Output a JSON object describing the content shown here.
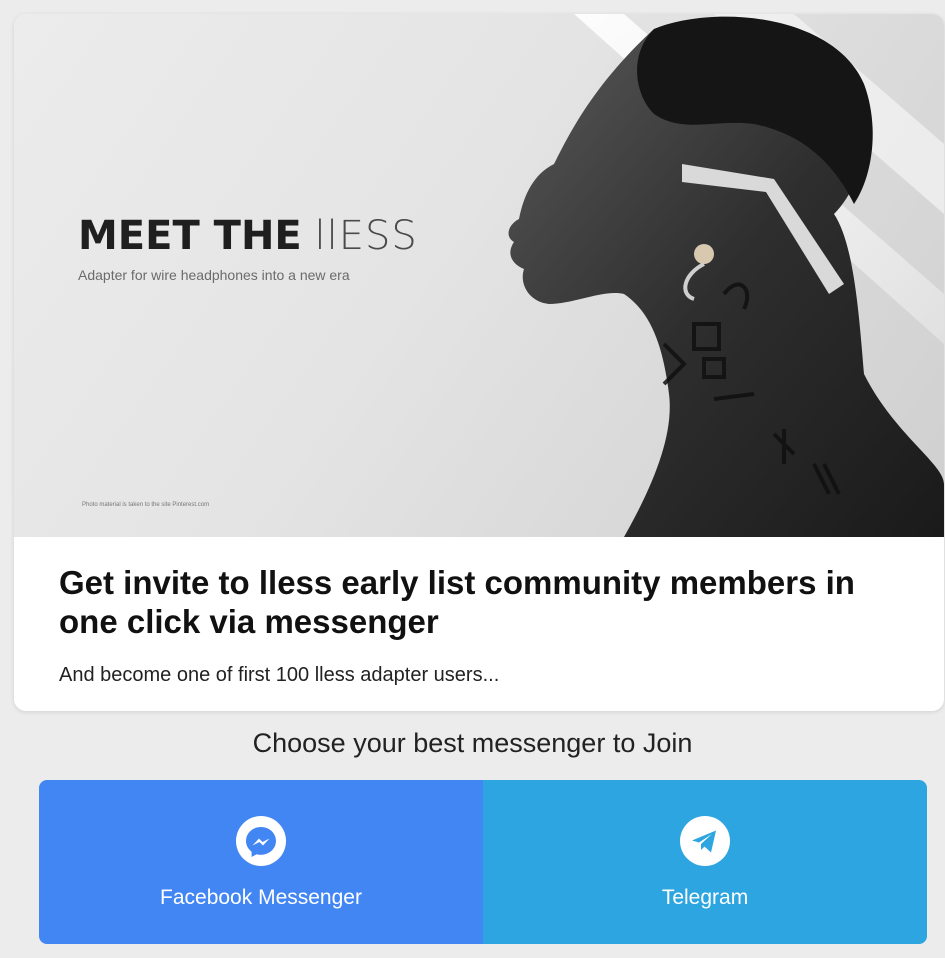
{
  "hero": {
    "title_bold": "MEET THE",
    "title_light": "llESS",
    "subtitle": "Adapter for wire headphones into a new era",
    "credit": "Photo material is taken to the site Pinterest.com"
  },
  "headline": "Get invite to lless early list community members in one click via messenger",
  "subline": "And become one of first 100 lless adapter users...",
  "choose_text": "Choose your best messenger to Join",
  "buttons": {
    "messenger": {
      "label": "Facebook Messenger",
      "icon": "messenger-icon",
      "color": "#4286f4"
    },
    "telegram": {
      "label": "Telegram",
      "icon": "telegram-icon",
      "color": "#2ca5e0"
    }
  },
  "colors": {
    "page_background": "#ececec",
    "card_background": "#ffffff",
    "headline": "#111111"
  }
}
